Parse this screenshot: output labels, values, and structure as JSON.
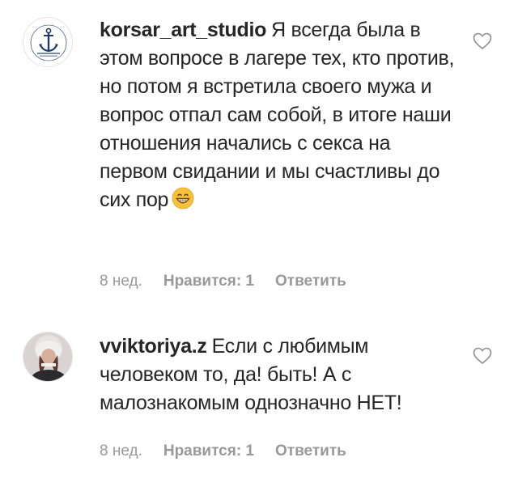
{
  "comments": [
    {
      "username": "korsar_art_studio",
      "text": "Я всегда была в этом вопросе в лагере тех, кто против, но потом я встретила своего мужа и вопрос отпал сам собой, в итоге наши отношения начались с секса на первом свидании и мы счастливы до сих пор",
      "emoji": "grinning-face-emoji",
      "time": "8 нед.",
      "likes": "Нравится: 1",
      "reply": "Ответить",
      "avatar": "anchor-logo-icon"
    },
    {
      "username": "vviktoriya.z",
      "text": "Если с любимым человеком то, да! быть! А с малознакомым однозначно НЕТ!",
      "time": "8 нед.",
      "likes": "Нравится: 1",
      "reply": "Ответить",
      "avatar": "user-photo"
    }
  ],
  "colors": {
    "text": "#262626",
    "meta": "#999999",
    "background": "#ffffff"
  }
}
